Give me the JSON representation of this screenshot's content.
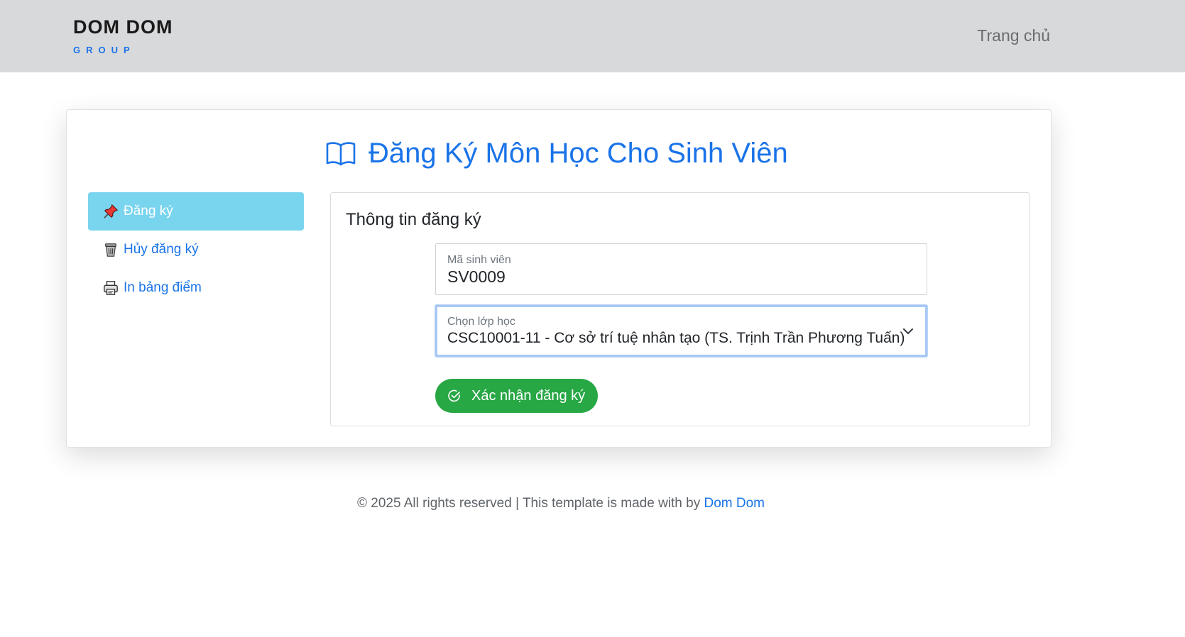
{
  "header": {
    "brand_name": "DOM DOM",
    "brand_sub": "GROUP",
    "nav_home": "Trang chủ"
  },
  "page": {
    "title": "Đăng Ký Môn Học Cho Sinh Viên",
    "title_icon": "book-open-icon"
  },
  "sidebar": {
    "items": [
      {
        "label": "Đăng ký",
        "icon": "pushpin-icon",
        "active": true
      },
      {
        "label": "Hủy đăng ký",
        "icon": "trash-icon",
        "active": false
      },
      {
        "label": "In bảng điểm",
        "icon": "printer-icon",
        "active": false
      }
    ]
  },
  "form": {
    "section_title": "Thông tin đăng ký",
    "student_id": {
      "label": "Mã sinh viên",
      "value": "SV0009"
    },
    "class_select": {
      "label": "Chọn lớp học",
      "selected": "CSC10001-11 - Cơ sở trí tuệ nhân tạo (TS. Trịnh Trần Phương Tuấn)"
    },
    "submit_label": "Xác nhận đăng ký"
  },
  "footer": {
    "text": "© 2025 All rights reserved | This template is made with by ",
    "link": "Dom Dom"
  },
  "colors": {
    "accent": "#1a73e8",
    "header_bg": "#d8d9db",
    "active_menu_bg": "#79d4ee",
    "confirm_button": "#28a745"
  }
}
